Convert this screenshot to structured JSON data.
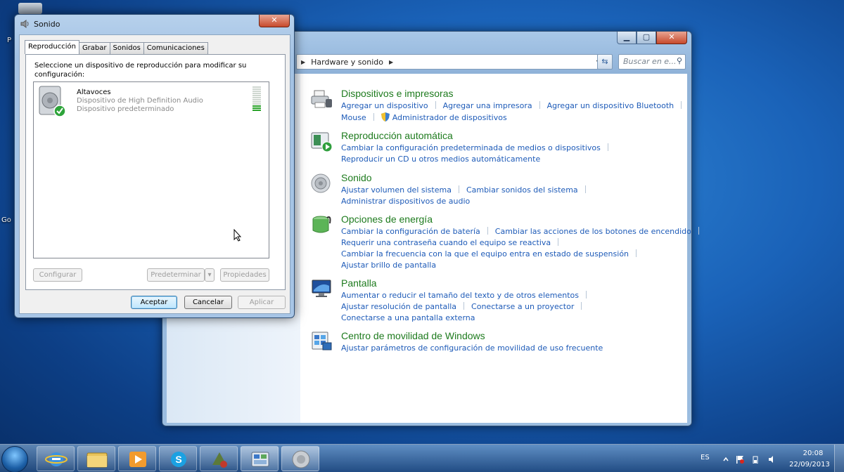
{
  "desktop": {
    "left_label_1": "P",
    "left_label_2": "Go"
  },
  "control_panel": {
    "breadcrumb": "Hardware y sonido",
    "search_placeholder": "Buscar en e...",
    "categories": [
      {
        "title": "Dispositivos e impresoras",
        "icon": "printer-icon",
        "lines": [
          [
            "Agregar un dispositivo",
            "Agregar una impresora",
            "Agregar un dispositivo Bluetooth"
          ],
          [
            "Mouse",
            "Administrador de dispositivos"
          ]
        ]
      },
      {
        "title": "Reproducción automática",
        "icon": "autoplay-icon",
        "lines": [
          [
            "Cambiar la configuración predeterminada de medios o dispositivos"
          ],
          [
            "Reproducir un CD u otros medios automáticamente"
          ]
        ]
      },
      {
        "title": "Sonido",
        "icon": "speaker-icon",
        "lines": [
          [
            "Ajustar volumen del sistema",
            "Cambiar sonidos del sistema"
          ],
          [
            "Administrar dispositivos de audio"
          ]
        ]
      },
      {
        "title": "Opciones de energía",
        "icon": "power-options-icon",
        "lines": [
          [
            "Cambiar la configuración de batería",
            "Cambiar las acciones de los botones de encendido"
          ],
          [
            "Requerir una contraseña cuando el equipo se reactiva"
          ],
          [
            "Cambiar la frecuencia con la que el equipo entra en estado de suspensión"
          ],
          [
            "Ajustar brillo de pantalla"
          ]
        ]
      },
      {
        "title": "Pantalla",
        "icon": "display-icon",
        "lines": [
          [
            "Aumentar o reducir el tamaño del texto y de otros elementos"
          ],
          [
            "Ajustar resolución de pantalla",
            "Conectarse a un proyector"
          ],
          [
            "Conectarse a una pantalla externa"
          ]
        ]
      },
      {
        "title": "Centro de movilidad de Windows",
        "icon": "mobility-center-icon",
        "lines": [
          [
            "Ajustar parámetros de configuración de movilidad de uso frecuente"
          ]
        ]
      }
    ]
  },
  "sound_dialog": {
    "title": "Sonido",
    "tabs": [
      "Reproducción",
      "Grabar",
      "Sonidos",
      "Comunicaciones"
    ],
    "active_tab": "Reproducción",
    "instruction": "Seleccione un dispositivo de reproducción para modificar su configuración:",
    "device": {
      "name": "Altavoces",
      "description": "Dispositivo de High Definition Audio",
      "status": "Dispositivo predeterminado",
      "level_fraction": 0.25
    },
    "buttons": {
      "configure": "Configurar",
      "set_default": "Predeterminar",
      "properties": "Propiedades",
      "ok": "Aceptar",
      "cancel": "Cancelar",
      "apply": "Aplicar"
    }
  },
  "taskbar": {
    "language": "ES",
    "time": "20:08",
    "date": "22/09/2013",
    "apps": [
      "internet-explorer-icon",
      "file-explorer-icon",
      "media-player-icon",
      "skype-icon",
      "app-icon",
      "control-panel-icon",
      "sound-icon"
    ]
  }
}
